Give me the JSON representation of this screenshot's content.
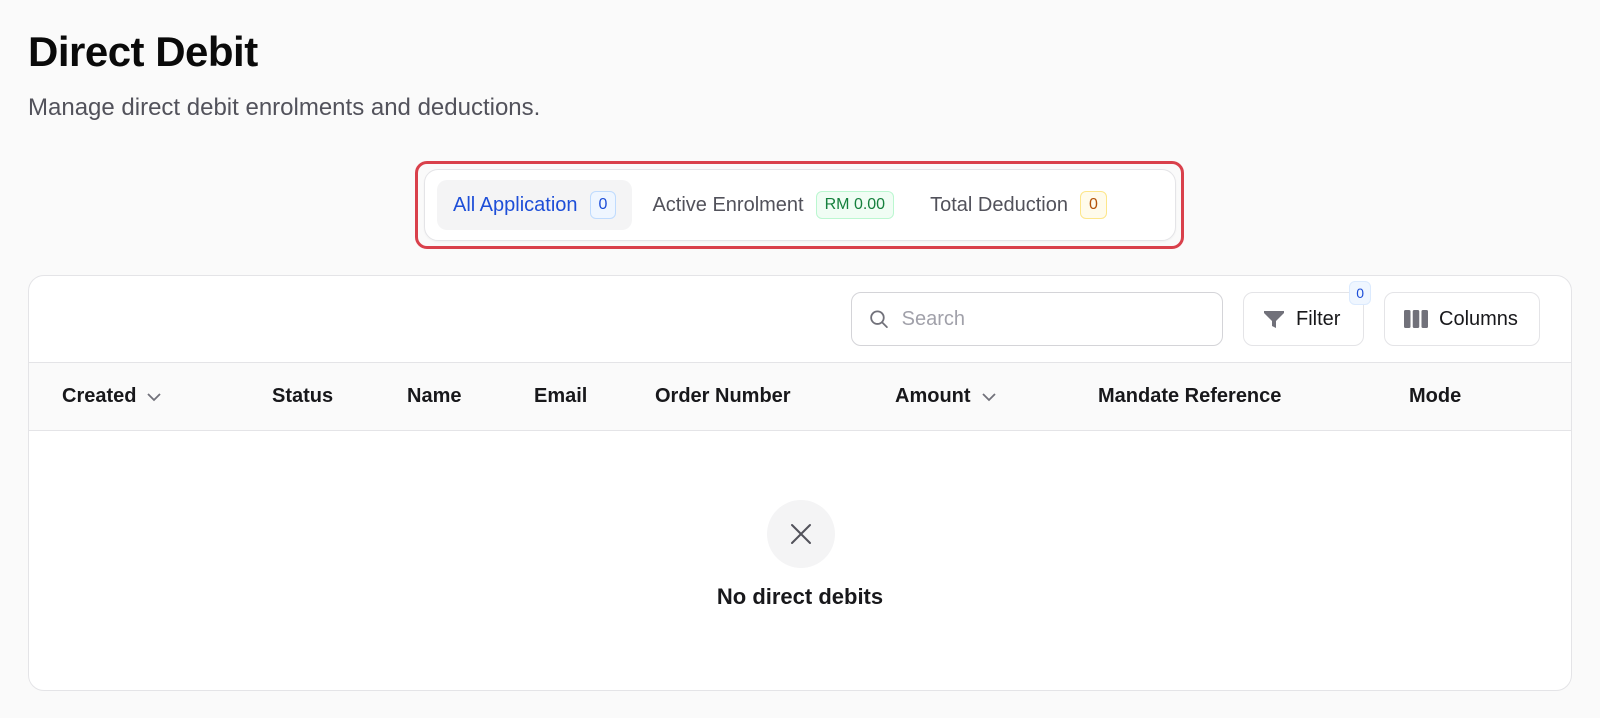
{
  "page": {
    "title": "Direct Debit",
    "subtitle": "Manage direct debit enrolments and deductions."
  },
  "tabs": [
    {
      "label": "All Application",
      "badge": "0",
      "active": true
    },
    {
      "label": "Active Enrolment",
      "badge": "RM 0.00",
      "active": false
    },
    {
      "label": "Total Deduction",
      "badge": "0",
      "active": false
    }
  ],
  "toolbar": {
    "search_placeholder": "Search",
    "filter_label": "Filter",
    "filter_count": "0",
    "columns_label": "Columns"
  },
  "table": {
    "columns": [
      "Created",
      "Status",
      "Name",
      "Email",
      "Order Number",
      "Amount",
      "Mandate Reference",
      "Mode"
    ],
    "rows": []
  },
  "empty_state": {
    "message": "No direct debits",
    "icon": "close-icon"
  },
  "colors": {
    "accent": "#1d4ed8",
    "highlight": "#d9404b",
    "success": "#15803d",
    "warning": "#b45309"
  }
}
